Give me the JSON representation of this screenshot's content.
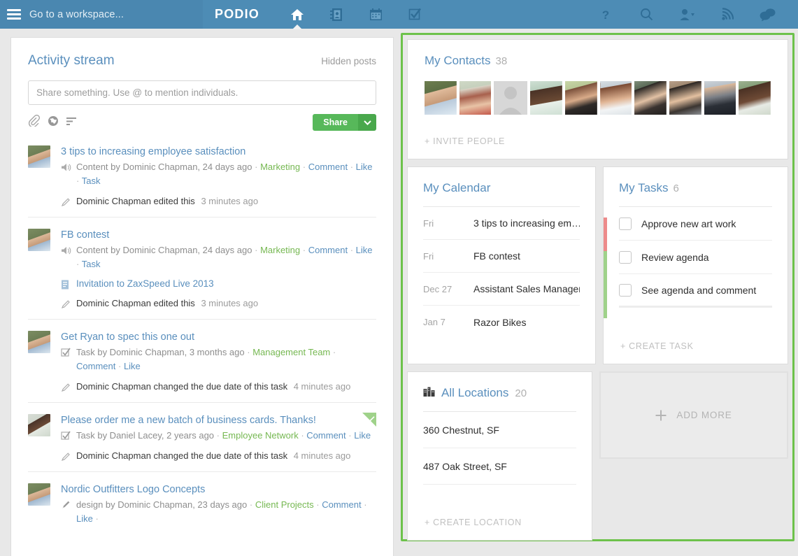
{
  "topbar": {
    "menu_icon": "hamburger-icon",
    "workspace_label": "Go to a workspace...",
    "brand": "PODIO",
    "nav": [
      {
        "name": "home",
        "icon": "home-icon",
        "active": true
      },
      {
        "name": "contacts",
        "icon": "contacts-book-icon",
        "active": false
      },
      {
        "name": "calendar",
        "icon": "calendar-icon",
        "active": false
      },
      {
        "name": "tasks",
        "icon": "check-square-icon",
        "active": false
      }
    ],
    "right_nav": [
      {
        "name": "help",
        "icon": "question-mark-icon"
      },
      {
        "name": "search",
        "icon": "search-icon"
      },
      {
        "name": "account",
        "icon": "person-dropdown-icon"
      },
      {
        "name": "notifications",
        "icon": "rss-icon"
      },
      {
        "name": "chat",
        "icon": "speech-bubbles-icon"
      }
    ],
    "colors": {
      "bar": "#4d8cb5",
      "bar_left": "#4a87b0",
      "icon": "#2f6d96"
    }
  },
  "activity": {
    "title": "Activity stream",
    "hidden_posts": "Hidden posts",
    "composer": {
      "placeholder": "Share something. Use @ to mention individuals.",
      "value": "",
      "icons": [
        "attach-icon",
        "globe-icon",
        "list-icon"
      ],
      "share_label": "Share",
      "caret": "chevron-down-icon"
    },
    "posts": [
      {
        "title": "3 tips to increasing employee satisfaction",
        "meta_icon": "megaphone-icon",
        "meta_prefix": "Content by Dominic Chapman, 24 days ago",
        "space": "Marketing",
        "actions": [
          "Comment",
          "Like",
          "Task"
        ],
        "attachment": null,
        "edit": "Dominic Chapman edited this",
        "edit_when": "3 minutes ago",
        "flag": false
      },
      {
        "title": "FB contest",
        "meta_icon": "megaphone-icon",
        "meta_prefix": "Content by Dominic Chapman, 24 days ago",
        "space": "Marketing",
        "actions": [
          "Comment",
          "Like",
          "Task"
        ],
        "attachment": "Invitation to ZaxSpeed Live 2013",
        "edit": "Dominic Chapman edited this",
        "edit_when": "3 minutes ago",
        "flag": false
      },
      {
        "title": "Get Ryan to spec this one out",
        "meta_icon": "check-square-icon",
        "meta_prefix": "Task by Dominic Chapman, 3 months ago",
        "space": "Management Team",
        "actions": [
          "Comment",
          "Like"
        ],
        "attachment": null,
        "edit": "Dominic Chapman changed the due date of this task",
        "edit_when": "4 minutes ago",
        "flag": false
      },
      {
        "title": "Please order me a new batch of business cards. Thanks!",
        "meta_icon": "check-square-icon",
        "meta_prefix": "Task by Daniel Lacey, 2 years ago",
        "space": "Employee Network",
        "actions": [
          "Comment",
          "Like"
        ],
        "attachment": null,
        "edit": "Dominic Chapman changed the due date of this task",
        "edit_when": "4 minutes ago",
        "flag": true
      },
      {
        "title": "Nordic Outfitters Logo Concepts",
        "meta_icon": "brush-icon",
        "meta_prefix": "design by Dominic Chapman, 23 days ago",
        "space": "Client Projects",
        "actions": [
          "Comment",
          "Like"
        ],
        "attachment": null,
        "edit": null,
        "edit_when": null,
        "flag": false
      }
    ]
  },
  "sidebar": {
    "highlight_color": "#6dc24b",
    "contacts": {
      "title": "My Contacts",
      "count": "38",
      "avatar_count": 10,
      "action": "+ INVITE PEOPLE"
    },
    "calendar": {
      "title": "My Calendar",
      "rows": [
        {
          "day": "Fri",
          "text": "3 tips to increasing em…"
        },
        {
          "day": "Fri",
          "text": "FB contest"
        },
        {
          "day": "Dec 27",
          "text": "Assistant Sales Manager"
        },
        {
          "day": "Jan 7",
          "text": "Razor Bikes"
        }
      ]
    },
    "tasks": {
      "title": "My Tasks",
      "count": "6",
      "rows": [
        {
          "label": "Approve new art work",
          "stripe": "#ed8a8a",
          "checked": false
        },
        {
          "label": "Review agenda",
          "stripe": "#9fd28a",
          "checked": false
        },
        {
          "label": "See agenda and comment",
          "stripe": "#9fd28a",
          "checked": false
        }
      ],
      "action": "+ CREATE TASK"
    },
    "locations": {
      "icon": "buildings-icon",
      "title": "All Locations",
      "count": "20",
      "rows": [
        "360 Chestnut, SF",
        "487 Oak Street, SF"
      ],
      "action": "+ CREATE LOCATION"
    },
    "add_more": {
      "icon": "plus-icon",
      "label": "ADD MORE"
    }
  }
}
